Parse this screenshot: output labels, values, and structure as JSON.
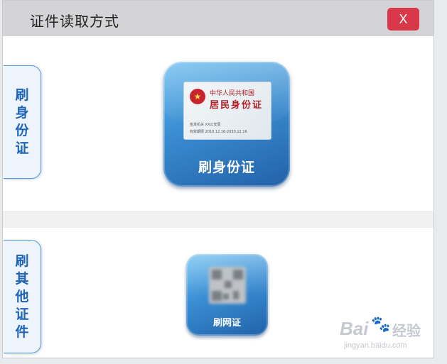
{
  "dialog": {
    "title": "证件读取方式",
    "close_label": "X"
  },
  "tabs": [
    {
      "chars": [
        "刷",
        "身",
        "份",
        "证"
      ]
    },
    {
      "chars": [
        "刷",
        "其",
        "他",
        "证",
        "件"
      ]
    }
  ],
  "id_card_tile": {
    "label": "刷身份证",
    "card": {
      "line1": "中华人民共和国",
      "line2": "居民身份证",
      "authority": "签发机关  XX公安局",
      "validity": "有效期限  2010.12.16-2030.12.16"
    }
  },
  "net_card_tile": {
    "label": "刷网证"
  },
  "watermark": {
    "brand": "Bai",
    "paw": "🐾",
    "site": "经验",
    "url": "jingyan.baidu.com"
  },
  "colors": {
    "title_bar": "#d4d4d6",
    "close_button": "#d9384a",
    "tab_text": "#1d63b8",
    "tile_blue": "#3a8cd1"
  },
  "icons": {
    "emblem": "national-emblem-icon",
    "qr": "qr-code-icon"
  }
}
